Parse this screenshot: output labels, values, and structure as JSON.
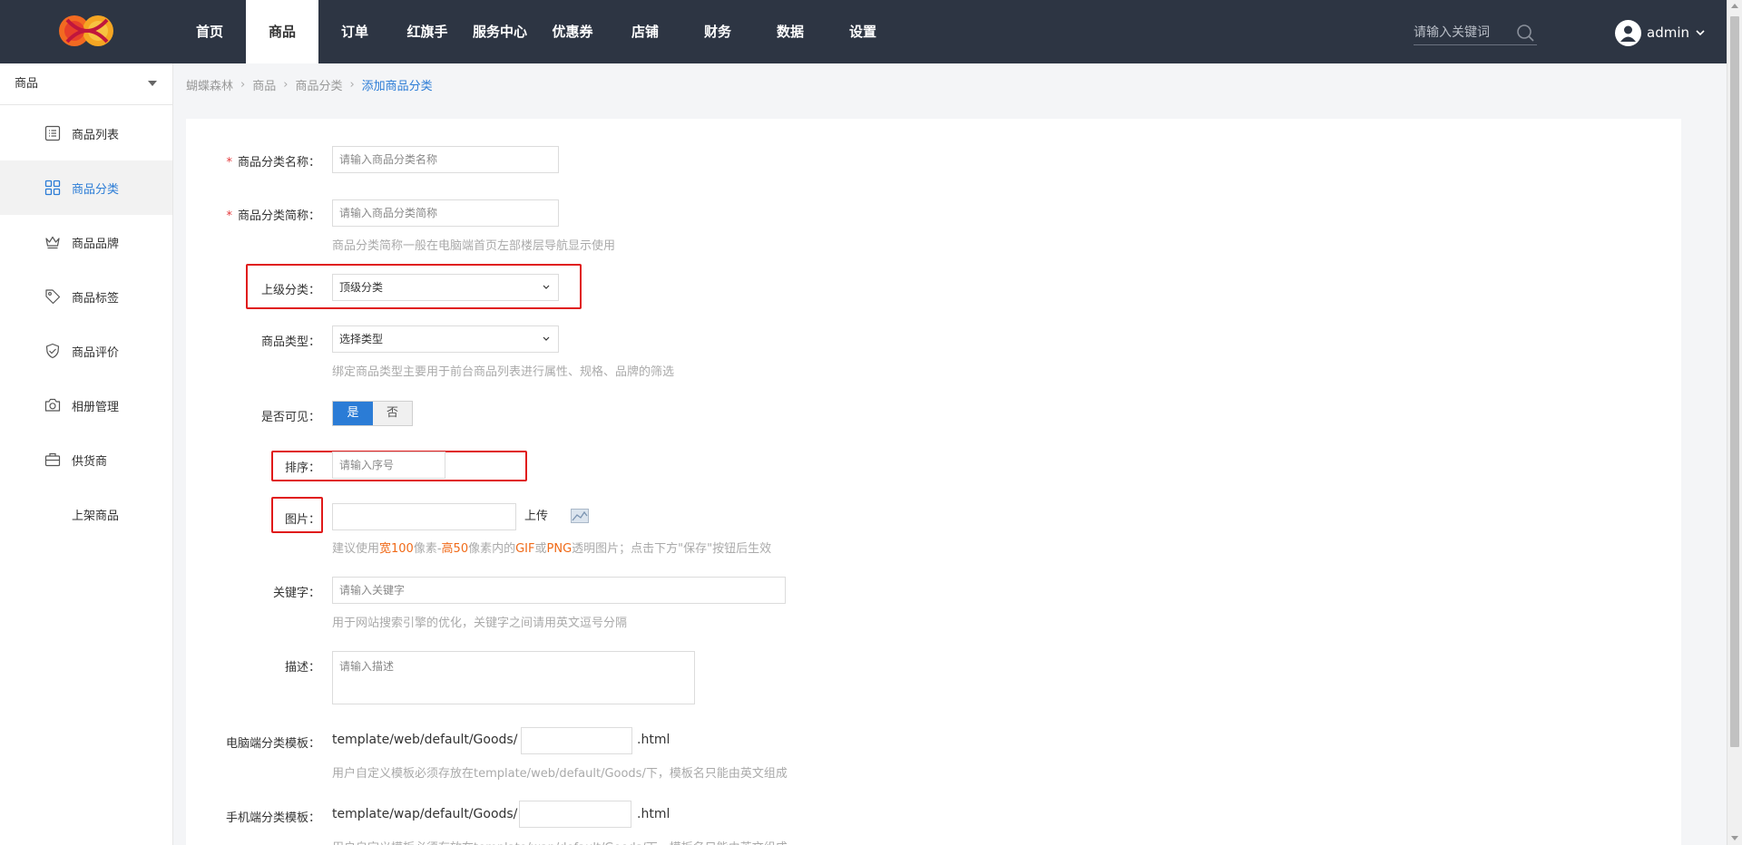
{
  "colors": {
    "topbar": "#2d3543",
    "accent": "#2b7cd6",
    "highlight": "#f06a18",
    "annotation": "#e01a1a",
    "required": "#e4393c"
  },
  "header": {
    "logo": "butterfly-logo",
    "nav": [
      "首页",
      "商品",
      "订单",
      "红旗手",
      "服务中心",
      "优惠券",
      "店铺",
      "财务",
      "数据",
      "设置"
    ],
    "active_nav": "商品",
    "search_placeholder": "请输入关键词",
    "user": "admin"
  },
  "sidebar": {
    "select_value": "商品",
    "items": [
      {
        "label": "商品列表",
        "icon": "list-icon"
      },
      {
        "label": "商品分类",
        "icon": "grid-icon",
        "active": true
      },
      {
        "label": "商品品牌",
        "icon": "crown-icon"
      },
      {
        "label": "商品标签",
        "icon": "tag-icon"
      },
      {
        "label": "商品评价",
        "icon": "shield-icon"
      },
      {
        "label": "相册管理",
        "icon": "camera-icon"
      },
      {
        "label": "供货商",
        "icon": "briefcase-icon"
      },
      {
        "label": "上架商品",
        "icon": ""
      }
    ]
  },
  "breadcrumb": [
    "蝴蝶森林",
    "商品",
    "商品分类",
    "添加商品分类"
  ],
  "form": {
    "name": {
      "label": "商品分类名称：",
      "placeholder": "请输入商品分类名称"
    },
    "short_name": {
      "label": "商品分类简称：",
      "placeholder": "请输入商品分类简称",
      "hint": "商品分类简称一般在电脑端首页左部楼层导航显示使用"
    },
    "parent": {
      "label": "上级分类：",
      "value": "顶级分类"
    },
    "type": {
      "label": "商品类型：",
      "value": "选择类型",
      "hint": "绑定商品类型主要用于前台商品列表进行属性、规格、品牌的筛选"
    },
    "visible": {
      "label": "是否可见：",
      "yes": "是",
      "no": "否"
    },
    "sort": {
      "label": "排序：",
      "placeholder": "请输入序号"
    },
    "image": {
      "label": "图片：",
      "upload": "上传",
      "hint": {
        "p1": "建议使用",
        "w": "宽100",
        "p2": "像素-",
        "h": "高50",
        "p3": "像素内的",
        "gif": "GIF",
        "p4": "或",
        "png": "PNG",
        "p5": "透明图片；点击下方\"保存\"按钮后生效"
      }
    },
    "keywords": {
      "label": "关键字：",
      "placeholder": "请输入关键字",
      "hint": "用于网站搜索引擎的优化，关键字之间请用英文逗号分隔"
    },
    "description": {
      "label": "描述：",
      "placeholder": "请输入描述"
    },
    "pc_template": {
      "label": "电脑端分类模板：",
      "prefix": "template/web/default/Goods/",
      "suffix": ".html",
      "hint": "用户自定义模板必须存放在template/web/default/Goods/下，模板名只能由英文组成"
    },
    "wap_template": {
      "label": "手机端分类模板：",
      "prefix": "template/wap/default/Goods/",
      "suffix": ".html",
      "hint": "用户自定义模板必须存放在template/wap/default/Goods/下，模板名只能由英文组成"
    }
  }
}
